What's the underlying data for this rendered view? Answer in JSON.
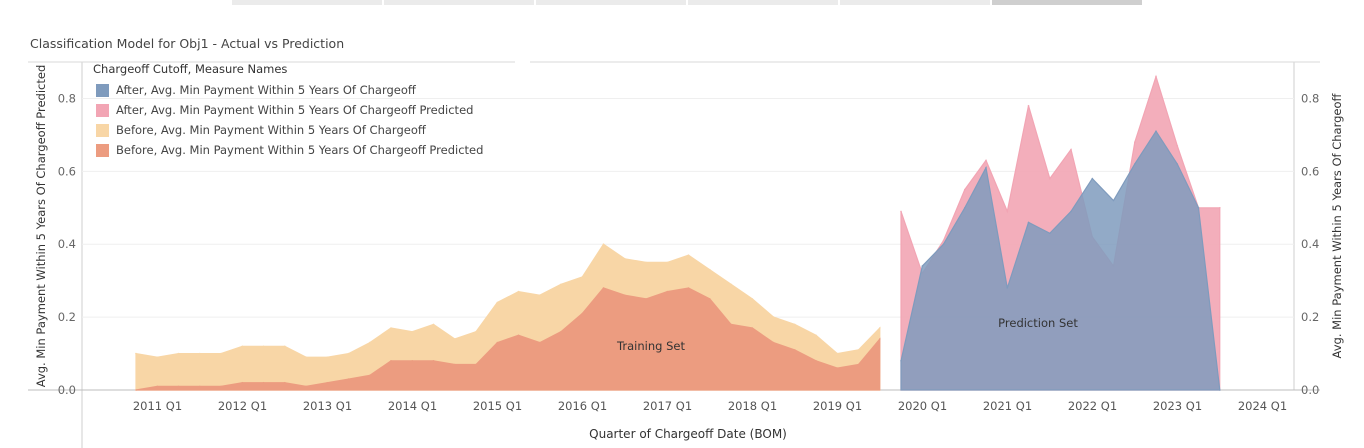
{
  "tabs": [
    {
      "label": ""
    },
    {
      "label": ""
    },
    {
      "label": ""
    },
    {
      "label": ""
    },
    {
      "label": ""
    },
    {
      "label": "",
      "active": true
    }
  ],
  "chart_title": "Classification Model for Obj1 - Actual vs Prediction",
  "chart_data": {
    "type": "area",
    "title": "Classification Model for Obj1 - Actual vs Prediction",
    "xlabel": "Quarter of Chargeoff Date (BOM)",
    "ylabel_left": "Avg. Min Payment Within 5 Years Of Chargeoff Predicted",
    "ylabel_right": "Avg. Min Payment Within 5 Years Of Chargeoff",
    "ylim": [
      0,
      0.9
    ],
    "yticks": [
      "0.0",
      "0.2",
      "0.4",
      "0.6",
      "0.8"
    ],
    "xticks": [
      "2011 Q1",
      "2012 Q1",
      "2013 Q1",
      "2014 Q1",
      "2015 Q1",
      "2016 Q1",
      "2017 Q1",
      "2018 Q1",
      "2019 Q1",
      "2020 Q1",
      "2021 Q1",
      "2022 Q1",
      "2023 Q1",
      "2024 Q1"
    ],
    "grid": true,
    "legend_title": "Chargeoff Cutoff, Measure Names",
    "legend_position": "top-left",
    "annotations": [
      {
        "text": "Training Set",
        "x": "2016 Q4",
        "y": 0.09
      },
      {
        "text": "Prediction Set",
        "x": "2021 Q3",
        "y": 0.17
      }
    ],
    "series": [
      {
        "name": "After, Avg. Min Payment Within 5 Years Of Chargeoff",
        "color": "#7f9bbd",
        "x": [
          "2020 Q1",
          "2020 Q2",
          "2020 Q3",
          "2020 Q4",
          "2021 Q1",
          "2021 Q2",
          "2021 Q3",
          "2021 Q4",
          "2022 Q1",
          "2022 Q2",
          "2022 Q3",
          "2022 Q4",
          "2023 Q1",
          "2023 Q2",
          "2023 Q3",
          "2023 Q4"
        ],
        "values": [
          0.08,
          0.34,
          0.4,
          0.5,
          0.61,
          0.28,
          0.46,
          0.43,
          0.49,
          0.58,
          0.52,
          0.62,
          0.71,
          0.62,
          0.5,
          0.0
        ]
      },
      {
        "name": "After, Avg. Min Payment Within 5 Years Of Chargeoff Predicted",
        "color": "#f2a5b4",
        "x": [
          "2020 Q1",
          "2020 Q2",
          "2020 Q3",
          "2020 Q4",
          "2021 Q1",
          "2021 Q2",
          "2021 Q3",
          "2021 Q4",
          "2022 Q1",
          "2022 Q2",
          "2022 Q3",
          "2022 Q4",
          "2023 Q1",
          "2023 Q2",
          "2023 Q3",
          "2023 Q4"
        ],
        "values": [
          0.49,
          0.32,
          0.41,
          0.55,
          0.63,
          0.49,
          0.78,
          0.58,
          0.66,
          0.42,
          0.34,
          0.68,
          0.86,
          0.67,
          0.5,
          0.5
        ]
      },
      {
        "name": "Before, Avg. Min Payment Within 5 Years Of Chargeoff",
        "color": "#f8d6a6",
        "x": [
          "2011 Q1",
          "2011 Q2",
          "2011 Q3",
          "2011 Q4",
          "2012 Q1",
          "2012 Q2",
          "2012 Q3",
          "2012 Q4",
          "2013 Q1",
          "2013 Q2",
          "2013 Q3",
          "2013 Q4",
          "2014 Q1",
          "2014 Q2",
          "2014 Q3",
          "2014 Q4",
          "2015 Q1",
          "2015 Q2",
          "2015 Q3",
          "2015 Q4",
          "2016 Q1",
          "2016 Q2",
          "2016 Q3",
          "2016 Q4",
          "2017 Q1",
          "2017 Q2",
          "2017 Q3",
          "2017 Q4",
          "2018 Q1",
          "2018 Q2",
          "2018 Q3",
          "2018 Q4",
          "2019 Q1",
          "2019 Q2",
          "2019 Q3",
          "2019 Q4"
        ],
        "values": [
          0.1,
          0.09,
          0.1,
          0.1,
          0.1,
          0.12,
          0.12,
          0.12,
          0.09,
          0.09,
          0.1,
          0.13,
          0.17,
          0.16,
          0.18,
          0.14,
          0.16,
          0.24,
          0.27,
          0.26,
          0.29,
          0.31,
          0.4,
          0.36,
          0.35,
          0.35,
          0.37,
          0.33,
          0.29,
          0.25,
          0.2,
          0.18,
          0.15,
          0.1,
          0.11,
          0.17
        ]
      },
      {
        "name": "Before, Avg. Min Payment Within 5 Years Of Chargeoff Predicted",
        "color": "#ec9c80",
        "x": [
          "2011 Q1",
          "2011 Q2",
          "2011 Q3",
          "2011 Q4",
          "2012 Q1",
          "2012 Q2",
          "2012 Q3",
          "2012 Q4",
          "2013 Q1",
          "2013 Q2",
          "2013 Q3",
          "2013 Q4",
          "2014 Q1",
          "2014 Q2",
          "2014 Q3",
          "2014 Q4",
          "2015 Q1",
          "2015 Q2",
          "2015 Q3",
          "2015 Q4",
          "2016 Q1",
          "2016 Q2",
          "2016 Q3",
          "2016 Q4",
          "2017 Q1",
          "2017 Q2",
          "2017 Q3",
          "2017 Q4",
          "2018 Q1",
          "2018 Q2",
          "2018 Q3",
          "2018 Q4",
          "2019 Q1",
          "2019 Q2",
          "2019 Q3",
          "2019 Q4"
        ],
        "values": [
          0.0,
          0.01,
          0.01,
          0.01,
          0.01,
          0.02,
          0.02,
          0.02,
          0.01,
          0.02,
          0.03,
          0.04,
          0.08,
          0.08,
          0.08,
          0.07,
          0.07,
          0.13,
          0.15,
          0.13,
          0.16,
          0.21,
          0.28,
          0.26,
          0.25,
          0.27,
          0.28,
          0.25,
          0.18,
          0.17,
          0.13,
          0.11,
          0.08,
          0.06,
          0.07,
          0.14
        ]
      }
    ]
  }
}
